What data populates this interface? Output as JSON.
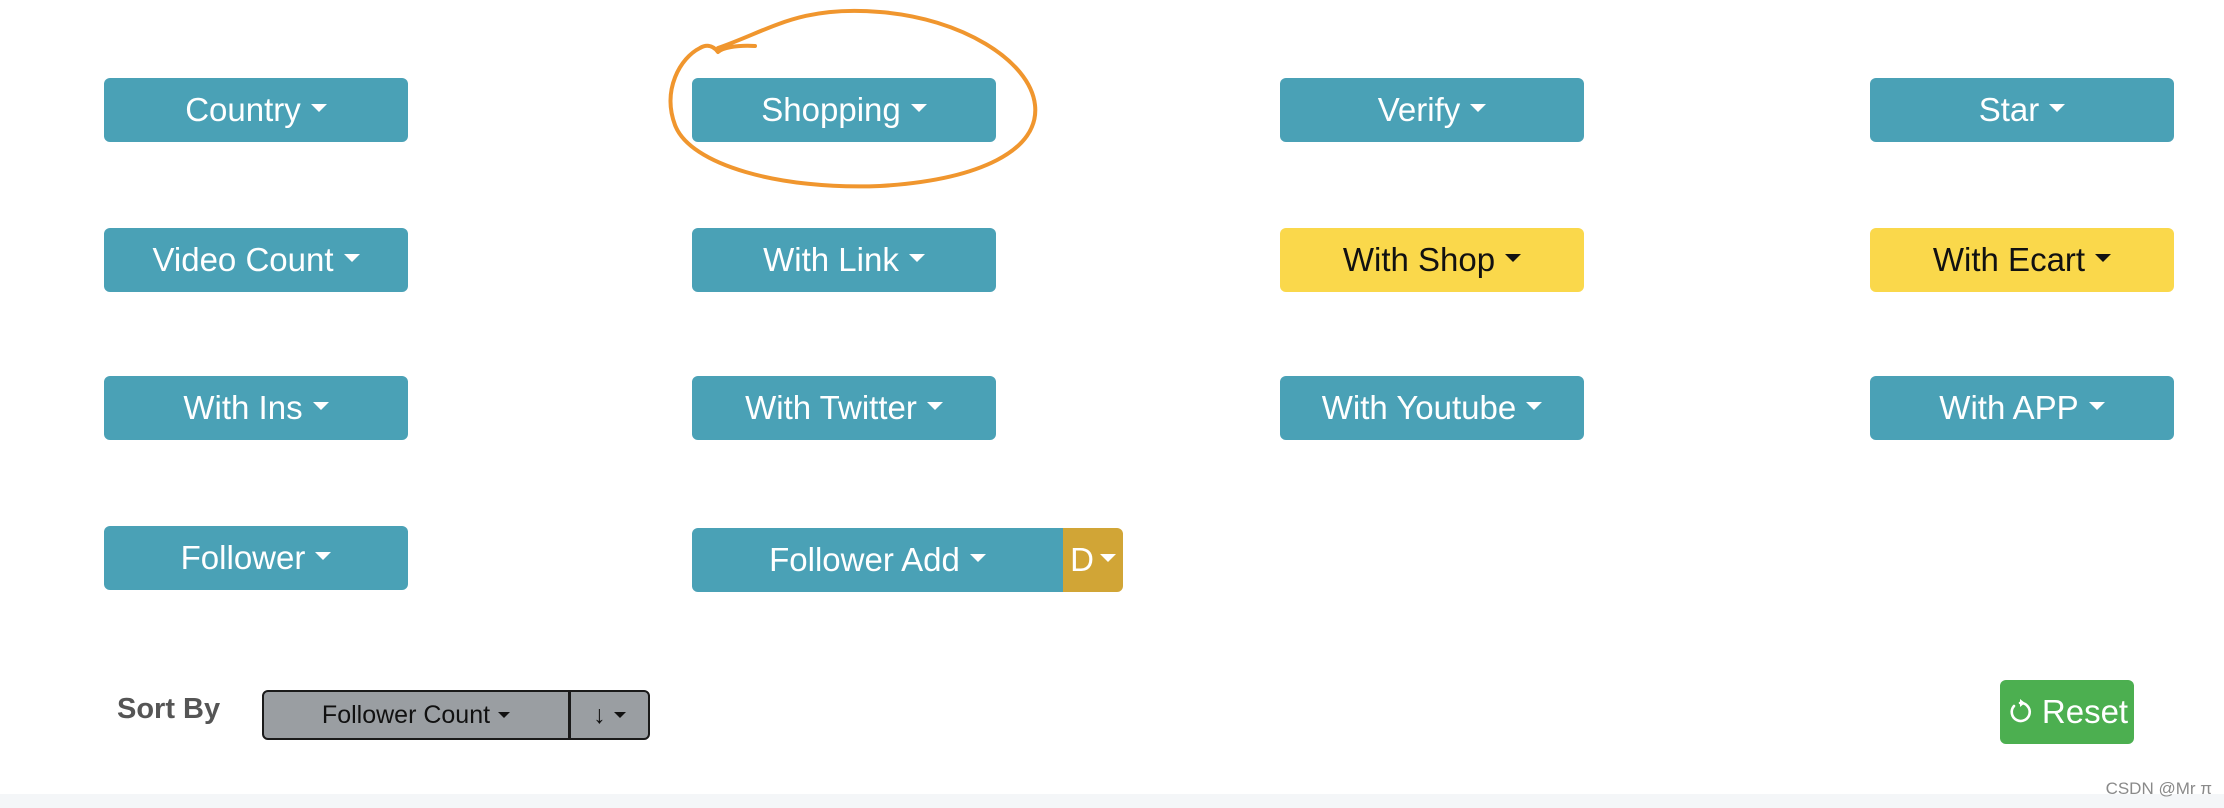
{
  "filters": {
    "country": "Country",
    "shopping": "Shopping",
    "verify": "Verify",
    "star": "Star",
    "video_count": "Video Count",
    "with_link": "With Link",
    "with_shop": "With Shop",
    "with_ecart": "With Ecart",
    "with_ins": "With Ins",
    "with_twitter": "With Twitter",
    "with_youtube": "With Youtube",
    "with_app": "With APP",
    "follower": "Follower",
    "follower_add": "Follower Add",
    "follower_add_direction": "D"
  },
  "sort": {
    "label": "Sort By",
    "field": "Follower Count",
    "order": "↓"
  },
  "reset": {
    "label": "Reset"
  },
  "watermark": "CSDN @Mr π",
  "colors": {
    "teal": "#4aa1b6",
    "yellow_active": "#fad84b",
    "gold": "#d1a536",
    "green": "#4caf50",
    "annotation_orange": "#f0962e"
  },
  "icons": {
    "caret": "caret-down-icon",
    "reset": "refresh-icon"
  }
}
